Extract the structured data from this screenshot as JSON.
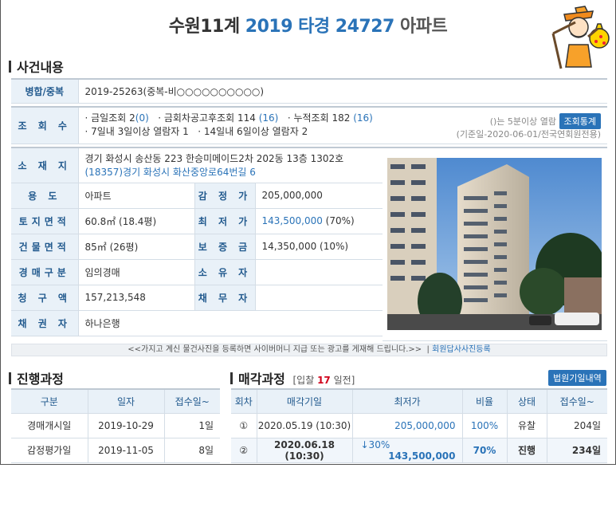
{
  "header": {
    "title_court": "수원11계",
    "title_case": "2019 타경 24727",
    "title_type": "아파트"
  },
  "section_case": {
    "heading": "사건내용",
    "merged_label": "병합/중복",
    "merged_value": "2019-25263(중복-비○○○○○○○○○○)",
    "views_label": "조 회 수",
    "views_today_label": "· 금일조회",
    "views_today": "2",
    "views_today_paren": "(0)",
    "views_after_label": "· 금회차공고후조회",
    "views_after": "114",
    "views_after_paren": "(16)",
    "views_total_label": "· 누적조회",
    "views_total": "182",
    "views_total_paren": "(16)",
    "views_7day": "· 7일내 3일이상 열람자 1",
    "views_14day": "· 14일내 6일이상 열람자 2",
    "views_note": "()는 5분이상 열람",
    "views_button": "조회통계",
    "views_basis": "(기준일-2020-06-01/전국연회원전용)",
    "location_label": "소 재 지",
    "location_addr": "경기 화성시 송산동 223 한승미메이드2차 202동 13층 1302호",
    "location_road": "(18357)경기 화성시  화산중앙로64번길  6",
    "usage_label": "용 도",
    "usage_value": "아파트",
    "appraisal_label": "감 정 가",
    "appraisal_value": "205,000,000",
    "land_label": "토지면적",
    "land_value": "60.8㎡ (18.4평)",
    "min_price_label": "최 저 가",
    "min_price_value": "143,500,000",
    "min_price_rate": "(70%)",
    "building_label": "건물면적",
    "building_value": "85㎡ (26평)",
    "deposit_label": "보 증 금",
    "deposit_value": "14,350,000 (10%)",
    "auction_type_label": "경매구분",
    "auction_type_value": "임의경매",
    "owner_label": "소 유 자",
    "owner_value": "",
    "claim_label": "청 구 액",
    "claim_value": "157,213,548",
    "debtor_label": "채 무 자",
    "debtor_value": "",
    "creditor_label": "채 권 자",
    "creditor_value": "하나은행",
    "notice": "<<가지고 계신 물건사진을 등록하면 사이버머니 지급 또는 광고를 게재해 드립니다.>>",
    "notice_link": "회원답사사진등록"
  },
  "progress": {
    "heading": "진행과정",
    "columns": [
      "구분",
      "일자",
      "접수일~"
    ],
    "rows": [
      [
        "경매개시일",
        "2019-10-29",
        "1일"
      ],
      [
        "감정평가일",
        "2019-11-05",
        "8일"
      ]
    ]
  },
  "sale": {
    "heading": "매각과정",
    "bid_prefix": "[입찰",
    "bid_days": "17",
    "bid_suffix": "일전]",
    "button": "법원기일내역",
    "columns": [
      "회차",
      "매각기일",
      "최저가",
      "비율",
      "상태",
      "접수일~"
    ],
    "rows": [
      {
        "round": "①",
        "date": "2020.05.19 (10:30)",
        "reduction": "",
        "price": "205,000,000",
        "rate": "100%",
        "status": "유찰",
        "days": "204일"
      },
      {
        "round": "②",
        "date": "2020.06.18 (10:30)",
        "reduction": "↓30%",
        "price": "143,500,000",
        "rate": "70%",
        "status": "진행",
        "days": "234일"
      }
    ]
  },
  "colors": {
    "accent": "#2a73b8",
    "label_bg": "#e9f1f8",
    "label_text": "#225a8e",
    "highlight": "#d0021b"
  }
}
